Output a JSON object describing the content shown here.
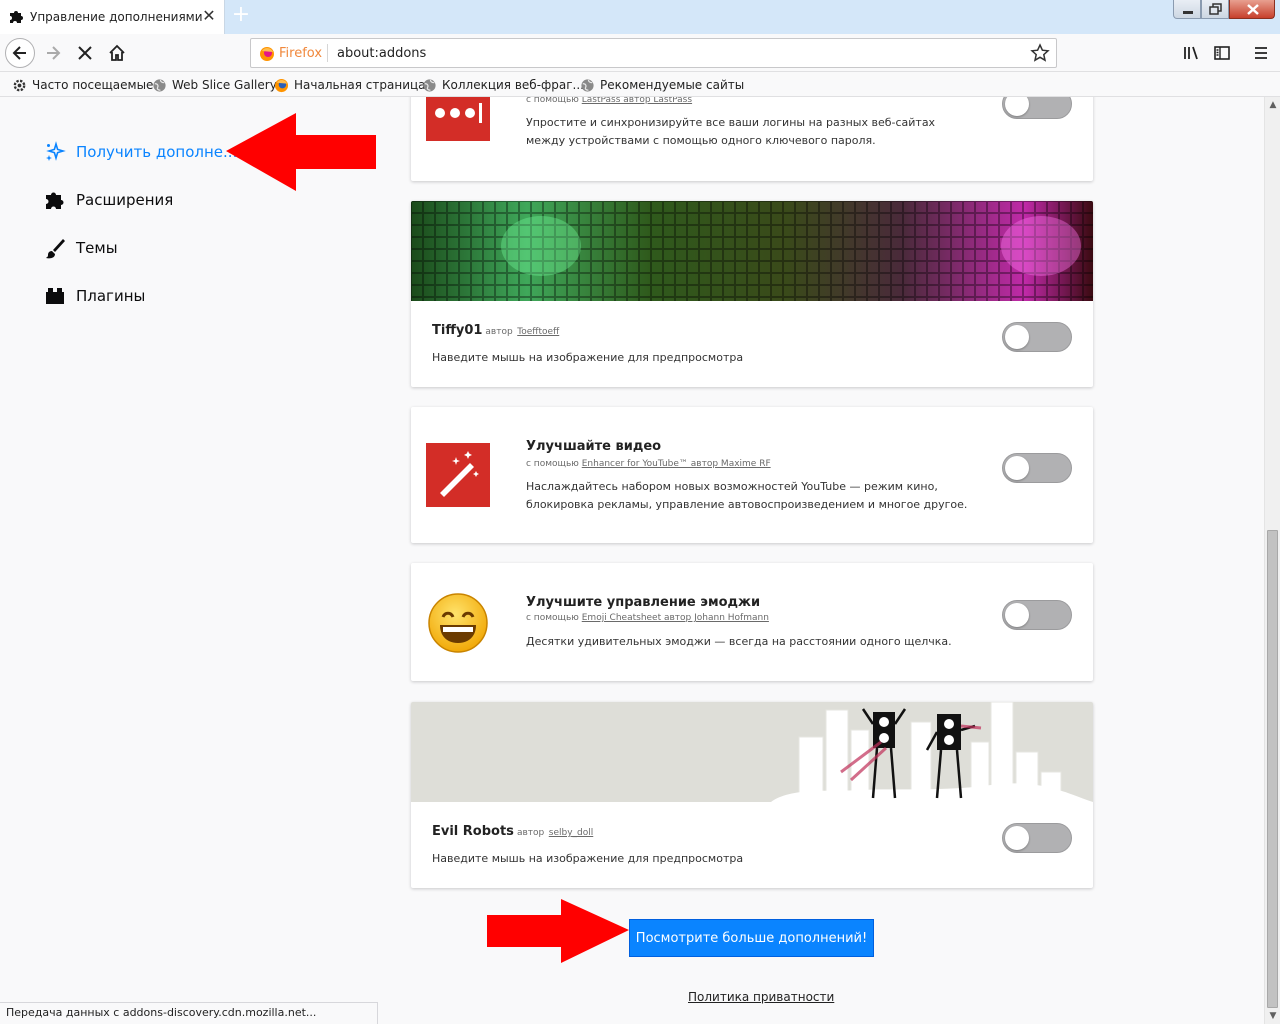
{
  "tab": {
    "title": "Управление дополнениями",
    "close": "✕",
    "new": "+"
  },
  "url": {
    "identity": "Firefox",
    "text": "about:addons"
  },
  "bookmarks": [
    {
      "label": "Часто посещаемые",
      "icon": "gear-icon"
    },
    {
      "label": "Web Slice Gallery",
      "icon": "globe-icon"
    },
    {
      "label": "Начальная страница",
      "icon": "firefox-icon"
    },
    {
      "label": "Коллекция веб-фраг...",
      "icon": "globe-icon"
    },
    {
      "label": "Рекомендуемые сайты",
      "icon": "globe-icon"
    }
  ],
  "categories": {
    "discover": "Получить дополне...",
    "extensions": "Расширения",
    "themes": "Темы",
    "plugins": "Плагины"
  },
  "cards": {
    "lastpass": {
      "by_prefix": "с помощью",
      "by_link": "LastPass автор LastPass",
      "desc": "Упростите и синхронизируйте все ваши логины на разных веб-сайтах между устройствами с помощью одного ключевого пароля."
    },
    "tiffy": {
      "name": "Tiffy01",
      "by": "автор",
      "author": "Toefftoeff",
      "hint": "Наведите мышь на изображение для предпросмотра"
    },
    "youtube": {
      "title": "Улучшайте видео",
      "by_prefix": "с помощью",
      "by_link": "Enhancer for YouTube™ автор Maxime RF",
      "desc": "Наслаждайтесь набором новых возможностей YouTube — режим кино, блокировка рекламы, управление автовоспроизведением и многое другое."
    },
    "emoji": {
      "title": "Улучшите управление эмоджи",
      "by_prefix": "с помощью",
      "by_link": "Emoji Cheatsheet автор Johann Hofmann",
      "desc": "Десятки удивительных эмоджи — всегда на расстоянии одного щелчка."
    },
    "robots": {
      "name": "Evil Robots",
      "by": "автор",
      "author": "selby_doll",
      "hint": "Наведите мышь на изображение для предпросмотра"
    }
  },
  "see_more": "Посмотрите больше дополнений!",
  "privacy": "Политика приватности",
  "status": "Передача данных с addons-discovery.cdn.mozilla.net...",
  "colors": {
    "accent": "#0a84ff",
    "arrow": "#ff0000",
    "lastpass": "#d32d27",
    "youtube": "#d32d27"
  }
}
